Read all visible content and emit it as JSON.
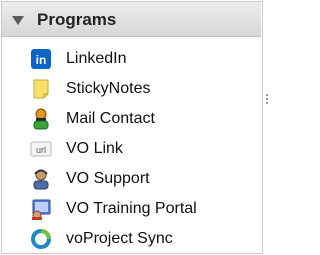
{
  "panel": {
    "title": "Programs",
    "items": [
      {
        "label": "LinkedIn",
        "icon": "linkedin-icon"
      },
      {
        "label": "StickyNotes",
        "icon": "sticky-note-icon"
      },
      {
        "label": "Mail Contact",
        "icon": "contact-person-icon"
      },
      {
        "label": "VO Link",
        "icon": "url-link-icon"
      },
      {
        "label": "VO Support",
        "icon": "support-agent-icon"
      },
      {
        "label": "VO Training Portal",
        "icon": "training-portal-icon"
      },
      {
        "label": "voProject Sync",
        "icon": "sync-ring-icon"
      }
    ]
  },
  "colors": {
    "linkedin_blue": "#0a66c2",
    "sticky_yellow": "#f7df6a",
    "sync_blue": "#1e88c7"
  }
}
